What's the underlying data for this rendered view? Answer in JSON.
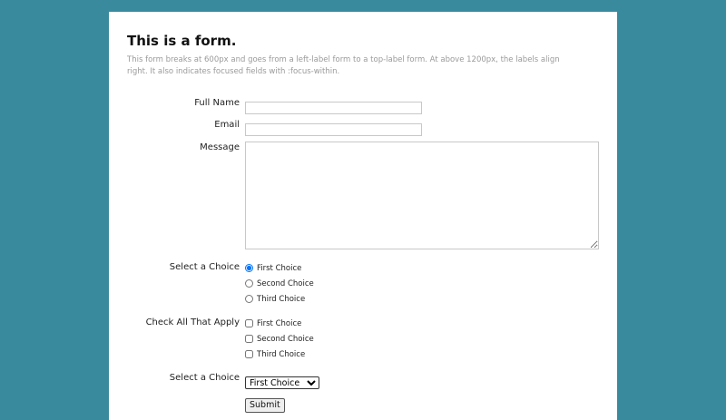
{
  "header": {
    "title": "This is a form.",
    "description": "This form breaks at 600px and goes from a left-label form to a top-label form. At above 1200px, the labels align right. It also indicates focused fields with :focus-within."
  },
  "form": {
    "full_name": {
      "label": "Full Name",
      "value": ""
    },
    "email": {
      "label": "Email",
      "value": ""
    },
    "message": {
      "label": "Message",
      "value": ""
    },
    "radio_group": {
      "label": "Select a Choice",
      "options": [
        "First Choice",
        "Second Choice",
        "Third Choice"
      ],
      "selected": "First Choice"
    },
    "checkbox_group": {
      "label": "Check All That Apply",
      "options": [
        "First Choice",
        "Second Choice",
        "Third Choice"
      ]
    },
    "select": {
      "label": "Select a Choice",
      "selected": "First Choice"
    },
    "submit_label": "Submit"
  }
}
